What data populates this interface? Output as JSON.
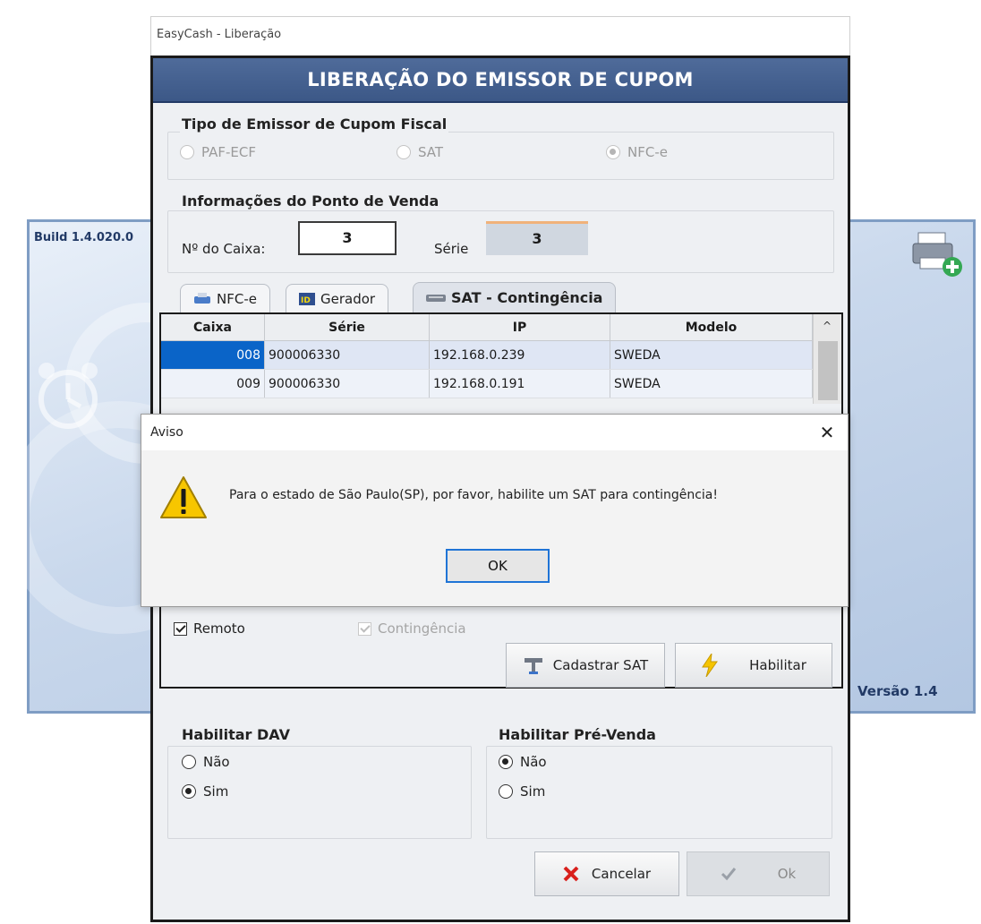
{
  "background": {
    "build_label": "Build 1.4.020.0",
    "version_label": "Versão 1.4",
    "printer_icon": "printer-add-icon",
    "alarm_icon": "alarm-clock-icon"
  },
  "window": {
    "title": "EasyCash - Liberação",
    "banner": "LIBERAÇÃO DO EMISSOR DE CUPOM"
  },
  "tipo_emissor": {
    "title": "Tipo de Emissor de Cupom Fiscal",
    "options": [
      {
        "label": "PAF-ECF",
        "selected": false
      },
      {
        "label": "SAT",
        "selected": false
      },
      {
        "label": "NFC-e",
        "selected": true
      }
    ]
  },
  "ponto_venda": {
    "title": "Informações do Ponto de Venda",
    "caixa_label": "Nº do Caixa:",
    "caixa_value": "3",
    "serie_label": "Série",
    "serie_value": "3"
  },
  "tabs": [
    {
      "label": "NFC-e",
      "icon": "printer-icon",
      "active": false
    },
    {
      "label": "Gerador",
      "icon": "id-card-icon",
      "active": false
    },
    {
      "label": "SAT - Contingência",
      "icon": "sat-device-icon",
      "active": true
    }
  ],
  "grid": {
    "columns": [
      "Caixa",
      "Série",
      "IP",
      "Modelo"
    ],
    "rows": [
      {
        "caixa": "008",
        "serie": "900006330",
        "ip": "192.168.0.239",
        "modelo": "SWEDA"
      },
      {
        "caixa": "009",
        "serie": "900006330",
        "ip": "192.168.0.191",
        "modelo": "SWEDA"
      }
    ],
    "scroll_up": "^"
  },
  "sat_options": {
    "remoto": "Remoto",
    "contingencia": "Contingência",
    "cadastrar_label": "Cadastrar SAT",
    "habilitar_label": "Habilitar"
  },
  "dav": {
    "title": "Habilitar DAV",
    "options": [
      {
        "label": "Não",
        "selected": false
      },
      {
        "label": "Sim",
        "selected": true
      }
    ]
  },
  "pre_venda": {
    "title": "Habilitar Pré-Venda",
    "options": [
      {
        "label": "Não",
        "selected": true
      },
      {
        "label": "Sim",
        "selected": false
      }
    ]
  },
  "footer": {
    "cancelar_label": "Cancelar",
    "ok_label": "Ok"
  },
  "modal": {
    "title": "Aviso",
    "close": "✕",
    "message": "Para o estado de São Paulo(SP), por favor, habilite um SAT para contingência!",
    "ok_label": "OK"
  },
  "colors": {
    "banner": "#3c5887",
    "selection": "#0a64c8",
    "ok_focus": "#1f74d6"
  }
}
